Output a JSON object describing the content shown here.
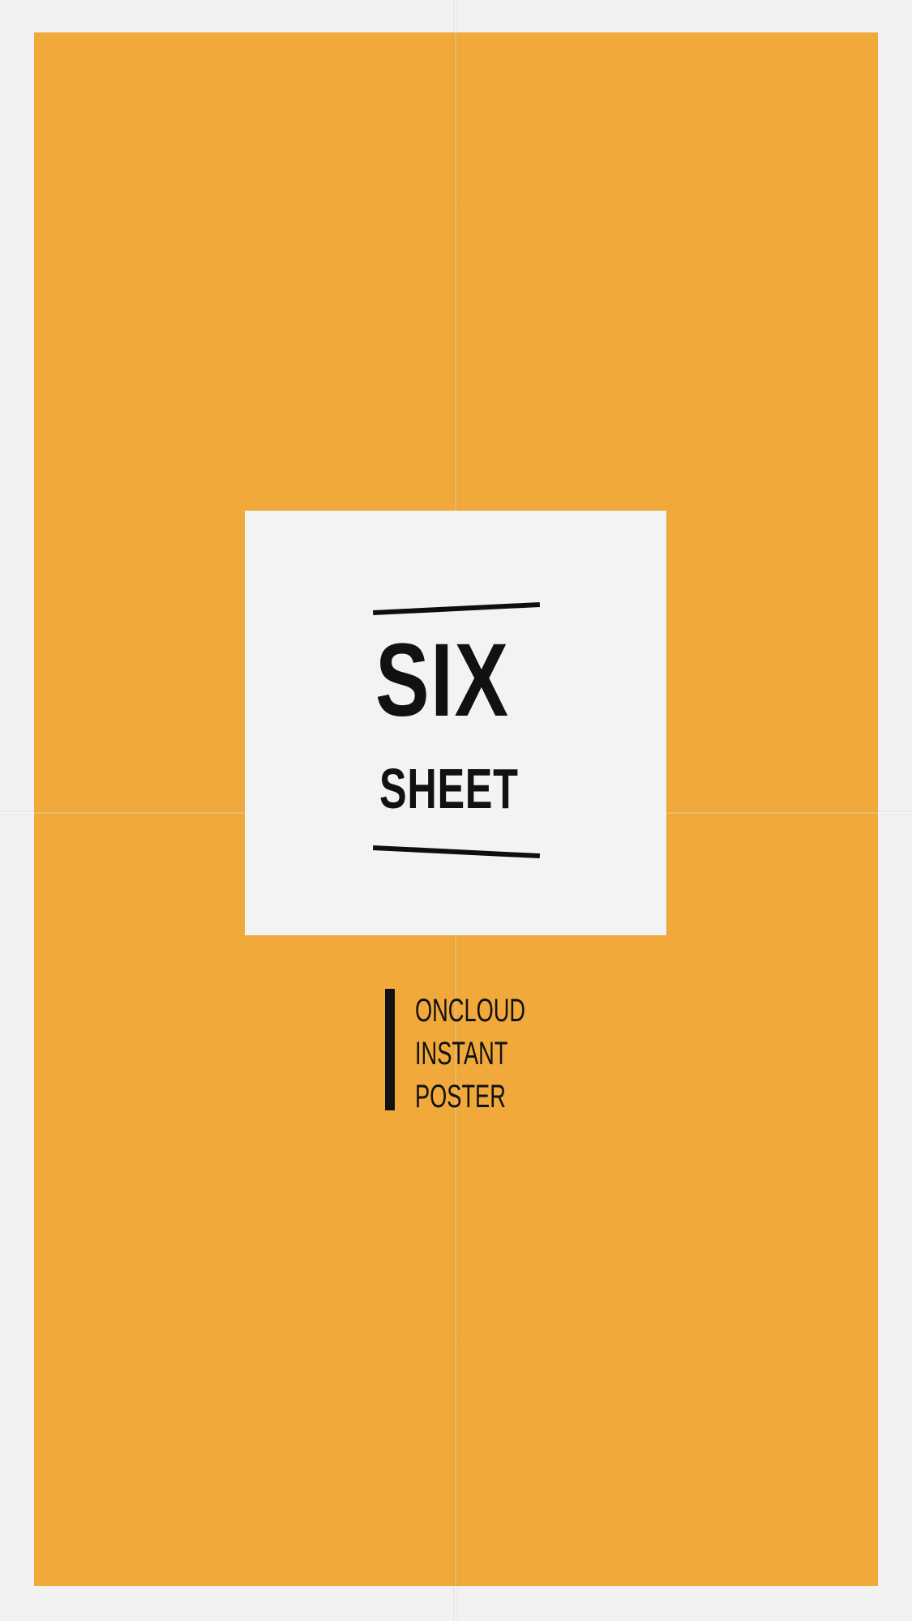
{
  "poster": {
    "title": "SIX",
    "subtitle": "SHEET",
    "tagline": [
      "ONCLOUD",
      "INSTANT",
      "POSTER"
    ],
    "colors": {
      "background": "#f1f1f1",
      "panel": "#f0a93a",
      "card": "#f3f3f3",
      "text": "#111111"
    }
  }
}
